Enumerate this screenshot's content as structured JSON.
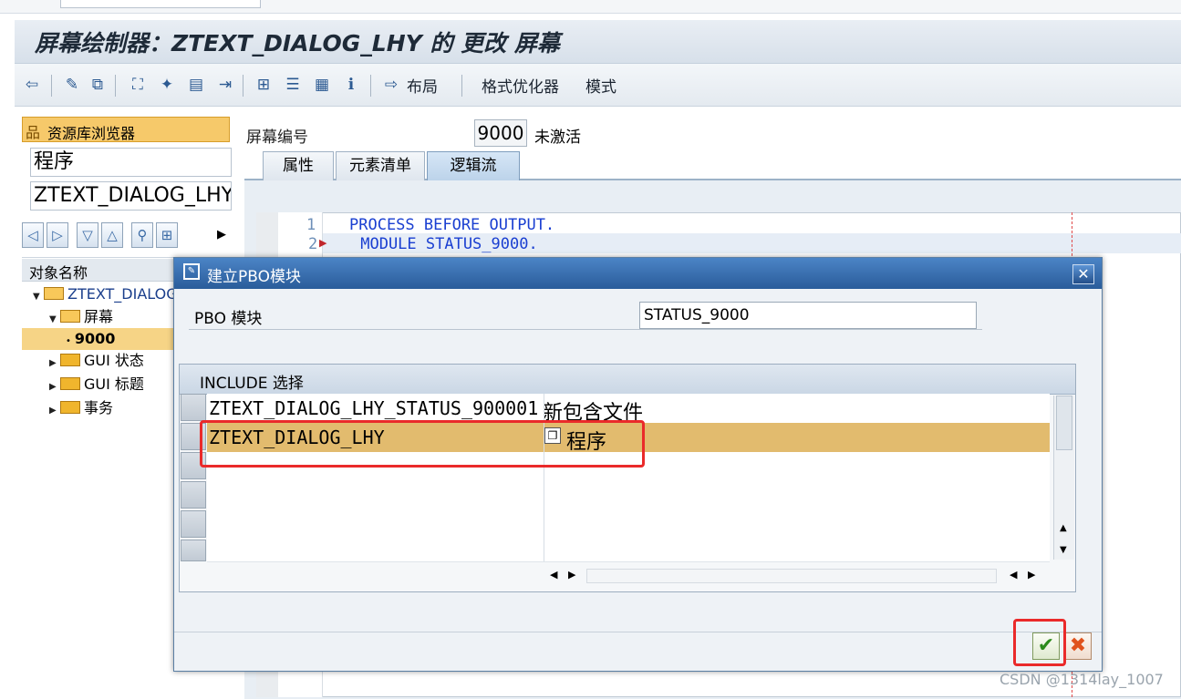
{
  "title": "屏幕绘制器：ZTEXT_DIALOG_LHY 的 更改 屏幕",
  "toolbar": {
    "layout_label": "布局",
    "formatter_label": "格式优化器",
    "mode_label": "模式"
  },
  "left": {
    "repo_label": "资源库浏览器",
    "type_value": "程序",
    "name_value": "ZTEXT_DIALOG_LHY",
    "tree_header": "对象名称",
    "tree": [
      {
        "label": "ZTEXT_DIALOG_LHY"
      },
      {
        "label": "屏幕"
      },
      {
        "label": "9000"
      },
      {
        "label": "GUI 状态"
      },
      {
        "label": "GUI 标题"
      },
      {
        "label": "事务"
      }
    ]
  },
  "screen": {
    "number_label": "屏幕编号",
    "number": "9000",
    "status": "未激活"
  },
  "tabs": [
    {
      "label": "属性"
    },
    {
      "label": "元素清单"
    },
    {
      "label": "逻辑流"
    }
  ],
  "editor": {
    "lines": [
      {
        "num": "1",
        "code": "PROCESS BEFORE OUTPUT."
      },
      {
        "num": "2",
        "code": " MODULE STATUS_9000."
      }
    ]
  },
  "dialog": {
    "title": "建立PBO模块",
    "pbo_label": "PBO 模块",
    "pbo_value": "STATUS_9000",
    "include_header": "INCLUDE 选择",
    "rows": [
      {
        "name": "ZTEXT_DIALOG_LHY_STATUS_900001",
        "desc": "新包含文件"
      },
      {
        "name": "ZTEXT_DIALOG_LHY",
        "desc": "程序"
      }
    ]
  },
  "watermark": "CSDN @1314lay_1007",
  "colors": {
    "selection": "#e2bb6e",
    "highlight_box": "#ea2a2a",
    "dialog_title": "#2f64a5"
  }
}
